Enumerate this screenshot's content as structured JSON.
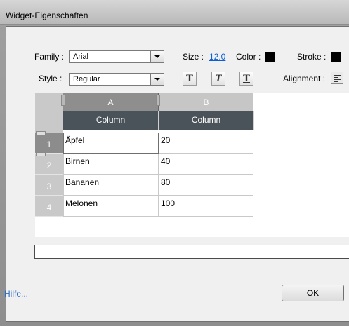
{
  "window": {
    "title": "Widget-Eigenschaften"
  },
  "toolbar": {
    "family_label": "Family :",
    "family_value": "Arial",
    "size_label": "Size :",
    "size_value": "12.0",
    "color_label": "Color :",
    "color_value": "#000000",
    "stroke_label": "Stroke :",
    "stroke_value": "#000000",
    "style_label": "Style :",
    "style_value": "Regular",
    "style_buttons": [
      "T",
      "T",
      "T"
    ],
    "alignment_label": "Alignment :"
  },
  "table": {
    "column_letters": [
      "A",
      "B"
    ],
    "column_titles": [
      "Column",
      "Column"
    ],
    "row_numbers": [
      "1",
      "2",
      "3",
      "4"
    ],
    "rows": [
      [
        "Äpfel",
        "20"
      ],
      [
        "Birnen",
        "40"
      ],
      [
        "Bananen",
        "80"
      ],
      [
        "Melonen",
        "100"
      ]
    ]
  },
  "footer": {
    "help_link": "Hilfe...",
    "ok_label": "OK"
  }
}
